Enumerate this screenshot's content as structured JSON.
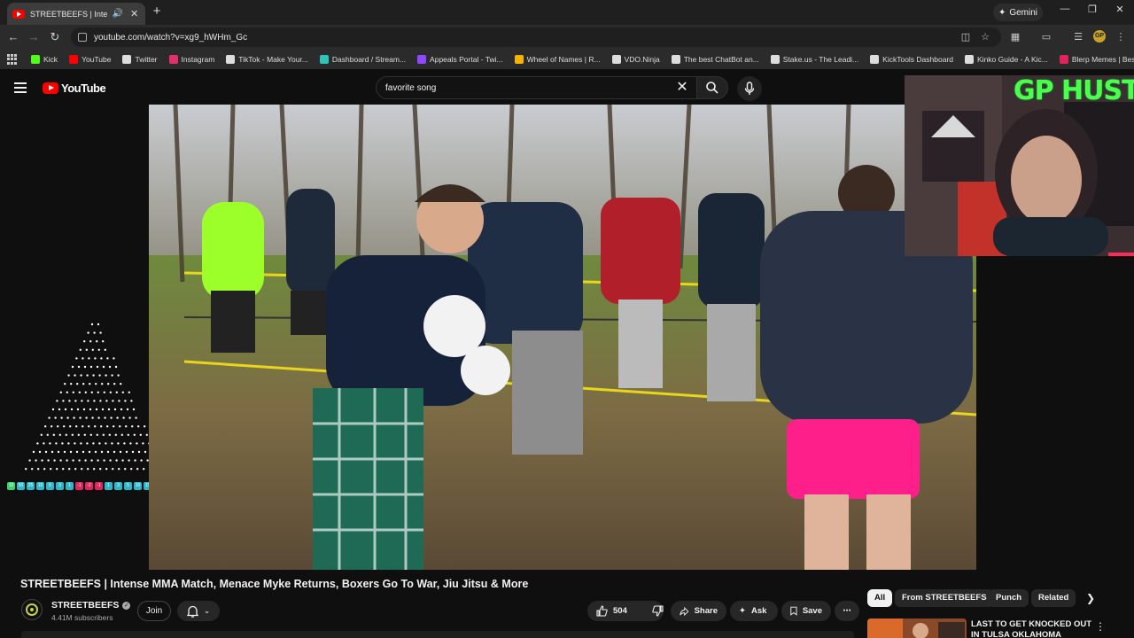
{
  "browser": {
    "tab_title": "STREETBEEFS | Intense MMA",
    "url": "youtube.com/watch?v=xg9_hWHm_Gc",
    "gemini_label": "Gemini",
    "bookmarks": [
      {
        "label": "Kick",
        "color": "#53fc18"
      },
      {
        "label": "YouTube",
        "color": "#ff0000"
      },
      {
        "label": "Twitter",
        "color": "#dddddd"
      },
      {
        "label": "Instagram",
        "color": "#e1306c"
      },
      {
        "label": "TikTok - Make Your...",
        "color": "#dddddd"
      },
      {
        "label": "Dashboard / Stream...",
        "color": "#2ec4b6"
      },
      {
        "label": "Appeals Portal - Twi...",
        "color": "#9146ff"
      },
      {
        "label": "Wheel of Names | R...",
        "color": "#f4b400"
      },
      {
        "label": "VDO.Ninja",
        "color": "#dddddd"
      },
      {
        "label": "The best ChatBot an...",
        "color": "#dddddd"
      },
      {
        "label": "Stake.us - The Leadi...",
        "color": "#dddddd"
      },
      {
        "label": "KickTools Dashboard",
        "color": "#dddddd"
      },
      {
        "label": "Kinko Guide - A Kic...",
        "color": "#dddddd"
      },
      {
        "label": "Blerp Memes | Best...",
        "color": "#e0245e"
      }
    ]
  },
  "youtube": {
    "logo_text": "YouTube",
    "search_value": "favorite song",
    "video": {
      "title": "STREETBEEFS | Intense MMA Match, Menace Myke Returns, Boxers Go To War, Jiu Jitsu & More",
      "channel": "STREETBEEFS",
      "subscribers": "4.41M subscribers",
      "join_label": "Join",
      "likes": "504",
      "share_label": "Share",
      "ask_label": "Ask",
      "save_label": "Save"
    },
    "chips": [
      "All",
      "From STREETBEEFS",
      "Punch",
      "Related"
    ],
    "recommendation": {
      "title": "LAST TO GET KNOCKED OUT IN TULSA OKLAHOMA"
    }
  },
  "overlay": {
    "webcam_text": "GP HUSTLA",
    "chips": [
      {
        "label": "10",
        "color": "#3bd16f"
      },
      {
        "label": "50",
        "color": "#2bb7c9"
      },
      {
        "label": "25",
        "color": "#2bb7c9"
      },
      {
        "label": "10",
        "color": "#2bb7c9"
      },
      {
        "label": "5",
        "color": "#2bb7c9"
      },
      {
        "label": "3",
        "color": "#2bb7c9"
      },
      {
        "label": "1",
        "color": "#2bb7c9"
      },
      {
        "label": "-1",
        "color": "#e0245e"
      },
      {
        "label": "-2",
        "color": "#e0245e"
      },
      {
        "label": "-1",
        "color": "#e0245e"
      },
      {
        "label": "1",
        "color": "#2bb7c9"
      },
      {
        "label": "3",
        "color": "#2bb7c9"
      },
      {
        "label": "5",
        "color": "#2bb7c9"
      },
      {
        "label": "10",
        "color": "#2bb7c9"
      },
      {
        "label": "15",
        "color": "#2bb7c9"
      },
      {
        "label": "25",
        "color": "#2bb7c9"
      },
      {
        "label": "50",
        "color": "#e0245e"
      },
      {
        "label": "100",
        "color": "#3bd16f"
      }
    ]
  }
}
